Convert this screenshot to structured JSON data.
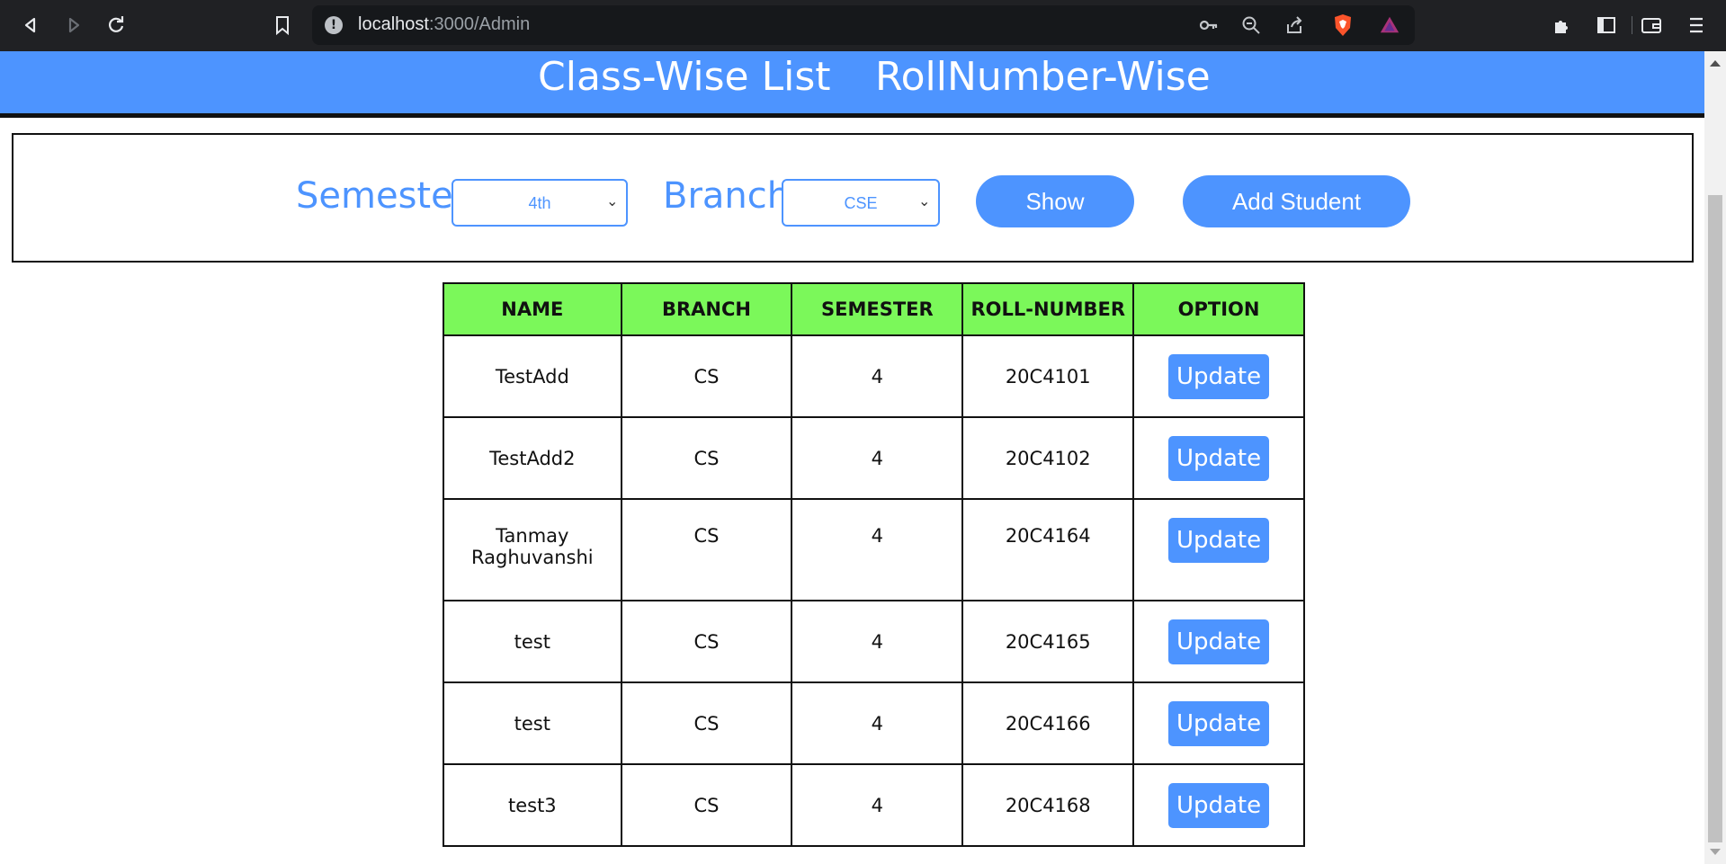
{
  "browser": {
    "url_host": "localhost",
    "url_path": ":3000/Admin"
  },
  "nav": {
    "class_wise": "Class-Wise List",
    "roll_wise": "RollNumber-Wise"
  },
  "filters": {
    "semester_label": "Semester",
    "semester_value": "4th",
    "branch_label": "Branch",
    "branch_value": "CSE",
    "show_label": "Show",
    "add_student_label": "Add Student"
  },
  "table": {
    "headers": [
      "NAME",
      "BRANCH",
      "SEMESTER",
      "ROLL-NUMBER",
      "OPTION"
    ],
    "rows": [
      {
        "name": "TestAdd",
        "branch": "CS",
        "semester": "4",
        "roll": "20C4101",
        "action": "Update"
      },
      {
        "name": "TestAdd2",
        "branch": "CS",
        "semester": "4",
        "roll": "20C4102",
        "action": "Update"
      },
      {
        "name": "Tanmay Raghuvanshi",
        "branch": "CS",
        "semester": "4",
        "roll": "20C4164",
        "action": "Update"
      },
      {
        "name": "test",
        "branch": "CS",
        "semester": "4",
        "roll": "20C4165",
        "action": "Update"
      },
      {
        "name": "test",
        "branch": "CS",
        "semester": "4",
        "roll": "20C4166",
        "action": "Update"
      },
      {
        "name": "test3",
        "branch": "CS",
        "semester": "4",
        "roll": "20C4168",
        "action": "Update"
      }
    ]
  },
  "colors": {
    "accent": "#4d94ff",
    "header_green": "#7bf85a",
    "chrome_bg": "#202124"
  }
}
